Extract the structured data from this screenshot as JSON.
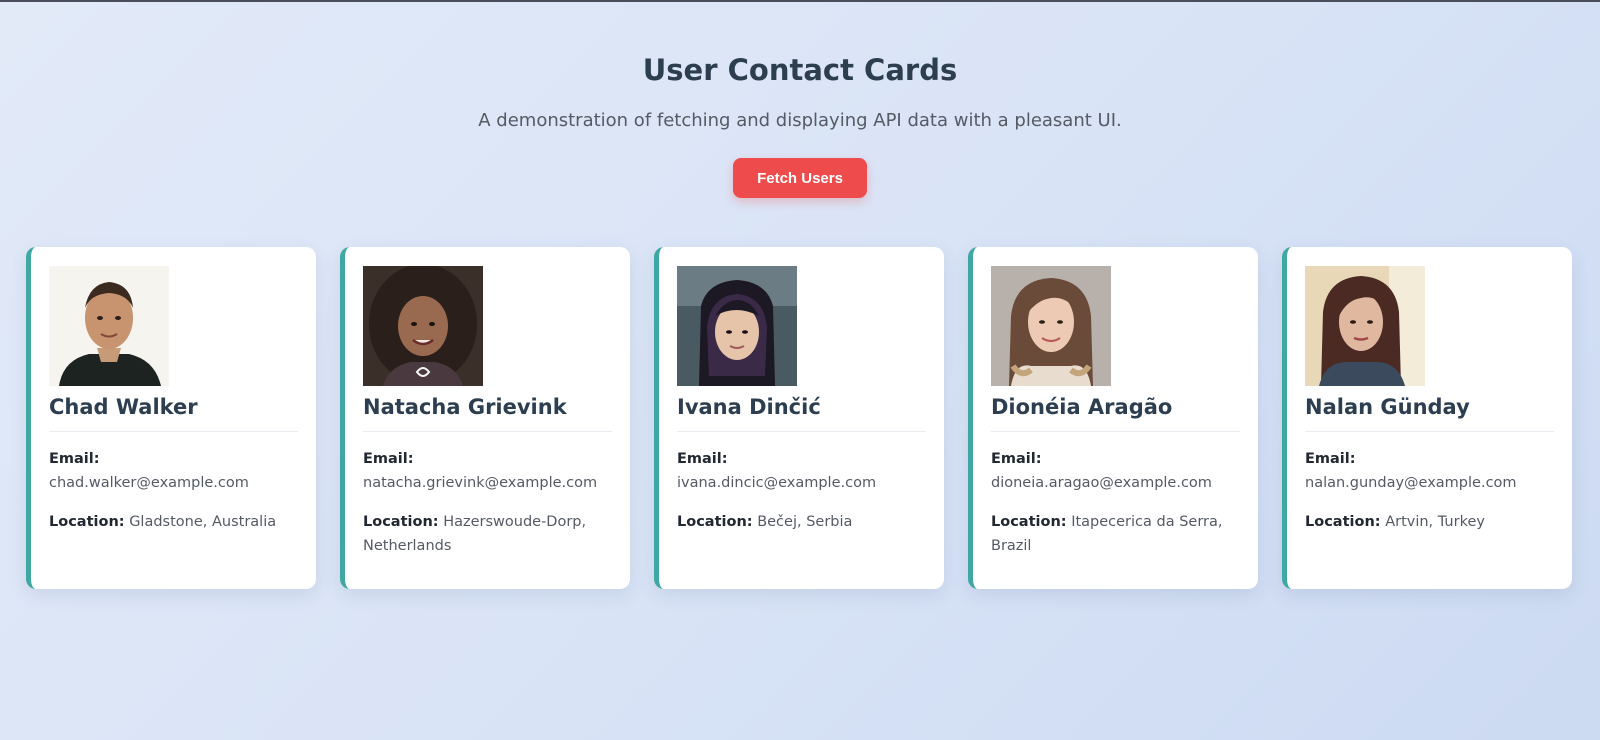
{
  "header": {
    "title": "User Contact Cards",
    "subtitle": "A demonstration of fetching and displaying API data with a pleasant UI.",
    "fetch_button_label": "Fetch Users"
  },
  "labels": {
    "email": "Email:",
    "location": "Location:"
  },
  "colors": {
    "accent_button": "#ee4c4c",
    "card_border": "#3fa8a2",
    "heading": "#2c3e50"
  },
  "users": [
    {
      "name": "Chad Walker",
      "email": "chad.walker@example.com",
      "location": "Gladstone, Australia",
      "avatar_icon": "user-photo"
    },
    {
      "name": "Natacha Grievink",
      "email": "natacha.grievink@example.com",
      "location": "Hazerswoude-Dorp, Netherlands",
      "avatar_icon": "user-photo"
    },
    {
      "name": "Ivana Dinčić",
      "email": "ivana.dincic@example.com",
      "location": "Bečej, Serbia",
      "avatar_icon": "user-photo"
    },
    {
      "name": "Dionéia Aragão",
      "email": "dioneia.aragao@example.com",
      "location": "Itapecerica da Serra, Brazil",
      "avatar_icon": "user-photo"
    },
    {
      "name": "Nalan Günday",
      "email": "nalan.gunday@example.com",
      "location": "Artvin, Turkey",
      "avatar_icon": "user-photo"
    }
  ]
}
